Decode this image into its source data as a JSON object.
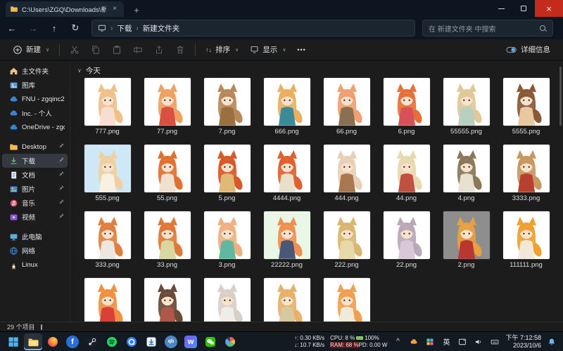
{
  "window": {
    "tab_title": "C:\\Users\\ZGQ\\Downloads\\新建",
    "tab_close": "×",
    "new_tab": "+",
    "minimize": "–",
    "close": "×"
  },
  "nav": {
    "back": "←",
    "forward": "→",
    "up": "↑",
    "refresh": "↻",
    "breadcrumb": {
      "crumb1": "下载",
      "crumb2": "新建文件夹",
      "sep": "›"
    },
    "search_placeholder": "在 新建文件夹 中搜索"
  },
  "toolbar": {
    "new_label": "新建",
    "sort_label": "排序",
    "sort_glyph": "↑↓",
    "view_label": "显示",
    "more_glyph": "•••",
    "details_label": "详细信息",
    "buttons": [
      {
        "name": "cut"
      },
      {
        "name": "copy"
      },
      {
        "name": "paste"
      },
      {
        "name": "rename"
      },
      {
        "name": "share"
      },
      {
        "name": "delete"
      }
    ]
  },
  "sidebar": {
    "sections": [
      {
        "items": [
          {
            "label": "主文件夹",
            "icon": "home"
          },
          {
            "label": "图库",
            "icon": "gallery"
          },
          {
            "label": "FNU - zgqinc2",
            "icon": "cloud"
          },
          {
            "label": "Inc. - 个人",
            "icon": "cloud"
          },
          {
            "label": "OneDrive - zgqinc",
            "icon": "cloud"
          }
        ]
      },
      {
        "items": [
          {
            "label": "Desktop",
            "icon": "folder",
            "pinned": true
          },
          {
            "label": "下载",
            "icon": "download",
            "pinned": true,
            "selected": true
          },
          {
            "label": "文档",
            "icon": "doc",
            "pinned": true
          },
          {
            "label": "图片",
            "icon": "pictures",
            "pinned": true
          },
          {
            "label": "音乐",
            "icon": "music",
            "pinned": true
          },
          {
            "label": "视频",
            "icon": "video",
            "pinned": true
          }
        ]
      },
      {
        "items": [
          {
            "label": "此电脑",
            "icon": "pc"
          },
          {
            "label": "网络",
            "icon": "network"
          },
          {
            "label": "Linux",
            "icon": "linux"
          }
        ]
      }
    ]
  },
  "content": {
    "group_label": "今天",
    "group_chevron": "∨",
    "files": [
      {
        "name": "777.png",
        "bg": "#ffffff",
        "hair": "#f0c08a",
        "dress": "#f8ded0"
      },
      {
        "name": "77.png",
        "bg": "#ffffff",
        "hair": "#f0a060",
        "dress": "#d85040"
      },
      {
        "name": "7.png",
        "bg": "#ffffff",
        "hair": "#b8885a",
        "dress": "#9a7040"
      },
      {
        "name": "666.png",
        "bg": "#ffffff",
        "hair": "#e8b060",
        "dress": "#3a8a9a"
      },
      {
        "name": "66.png",
        "bg": "#ffffff",
        "hair": "#f0a070",
        "dress": "#8a7050"
      },
      {
        "name": "6.png",
        "bg": "#ffffff",
        "hair": "#e87038",
        "dress": "#d85058"
      },
      {
        "name": "55555.png",
        "bg": "#ffffff",
        "hair": "#e0c898",
        "dress": "#b8d0c0"
      },
      {
        "name": "5555.png",
        "bg": "#ffffff",
        "hair": "#8a5a38",
        "dress": "#e8c8a0"
      },
      {
        "name": "555.png",
        "bg": "#cfe8f8",
        "hair": "#f0d0a0",
        "dress": "#f8f0e0"
      },
      {
        "name": "55.png",
        "bg": "#ffffff",
        "hair": "#e07030",
        "dress": "#f0e0d0"
      },
      {
        "name": "5.png",
        "bg": "#ffffff",
        "hair": "#d85828",
        "dress": "#e0b878"
      },
      {
        "name": "4444.png",
        "bg": "#ffffff",
        "hair": "#e06030",
        "dress": "#e8e0c8"
      },
      {
        "name": "444.png",
        "bg": "#ffffff",
        "hair": "#e8d0b8",
        "dress": "#a87850"
      },
      {
        "name": "44.png",
        "bg": "#ffffff",
        "hair": "#e8d8b0",
        "dress": "#c05040"
      },
      {
        "name": "4.png",
        "bg": "#ffffff",
        "hair": "#8a7858",
        "dress": "#e8e0d0"
      },
      {
        "name": "3333.png",
        "bg": "#ffffff",
        "hair": "#c89860",
        "dress": "#b84030"
      },
      {
        "name": "333.png",
        "bg": "#ffffff",
        "hair": "#e08040",
        "dress": "#ece8e0"
      },
      {
        "name": "33.png",
        "bg": "#ffffff",
        "hair": "#e07838",
        "dress": "#d8d8a0"
      },
      {
        "name": "3.png",
        "bg": "#ffffff",
        "hair": "#f0b080",
        "dress": "#60b8a0"
      },
      {
        "name": "22222.png",
        "bg": "#eaf6e6",
        "hair": "#f09050",
        "dress": "#4a5878"
      },
      {
        "name": "222.png",
        "bg": "#ffffff",
        "hair": "#d8b870",
        "dress": "#e8d8a8"
      },
      {
        "name": "22.png",
        "bg": "#ffffff",
        "hair": "#b8a8b8",
        "dress": "#d8c8d8"
      },
      {
        "name": "2.png",
        "bg": "#8e8e8e",
        "hair": "#e8a040",
        "dress": "#b83830"
      },
      {
        "name": "111111.png",
        "bg": "#ffffff",
        "hair": "#f0a030",
        "dress": "#f0e8d8"
      },
      {
        "name": "",
        "bg": "#ffffff",
        "hair": "#f09040",
        "dress": "#d84038"
      },
      {
        "name": "",
        "bg": "#ffffff",
        "hair": "#6a4a38",
        "dress": "#b05848"
      },
      {
        "name": "",
        "bg": "#ffffff",
        "hair": "#d8d0c8",
        "dress": "#f0ece8"
      },
      {
        "name": "",
        "bg": "#ffffff",
        "hair": "#e8b068",
        "dress": "#d8c8a0"
      },
      {
        "name": "",
        "bg": "#ffffff",
        "hair": "#f0a050",
        "dress": "#f0ead8"
      }
    ]
  },
  "statusbar": {
    "items_text": "29 个项目"
  },
  "taskbar": {
    "apps": [
      {
        "name": "start"
      },
      {
        "name": "file-explorer",
        "active": true
      },
      {
        "name": "firefox"
      },
      {
        "name": "f-app",
        "glyph": "f",
        "bg": "#2a6fd8"
      },
      {
        "name": "steam"
      },
      {
        "name": "spotify"
      },
      {
        "name": "quark"
      },
      {
        "name": "downloader"
      },
      {
        "name": "qbittorrent",
        "glyph": "qb",
        "bg": "#4a86c8"
      },
      {
        "name": "watt-toolkit",
        "glyph": "w",
        "bg": "linear-gradient(135deg,#7a5af0,#4a90f0)"
      },
      {
        "name": "wechat"
      },
      {
        "name": "paint-app"
      }
    ],
    "tray": {
      "net_up": "↑: 0.30 KB/s",
      "net_down": "↓: 10.7 KB/s",
      "cpu": "CPU: 8 %",
      "battery_pct": "100%",
      "ram": "RAM: 68 %",
      "power": "PD: 0.00 W",
      "icons": [
        {
          "name": "hidden-icons-chevron",
          "glyph": "^"
        },
        {
          "name": "cloud-drive",
          "icon": "traycloud"
        },
        {
          "name": "colorful-app",
          "icon": "colorgrid"
        },
        {
          "name": "ime-indicator",
          "glyph": "英"
        },
        {
          "name": "tablet",
          "icon": "tablet"
        },
        {
          "name": "speaker",
          "icon": "speaker"
        },
        {
          "name": "touch-keyboard",
          "icon": "keyboard"
        }
      ],
      "time": "下午 7:12:58",
      "date": "2023/10/6",
      "bell": "bell"
    }
  }
}
